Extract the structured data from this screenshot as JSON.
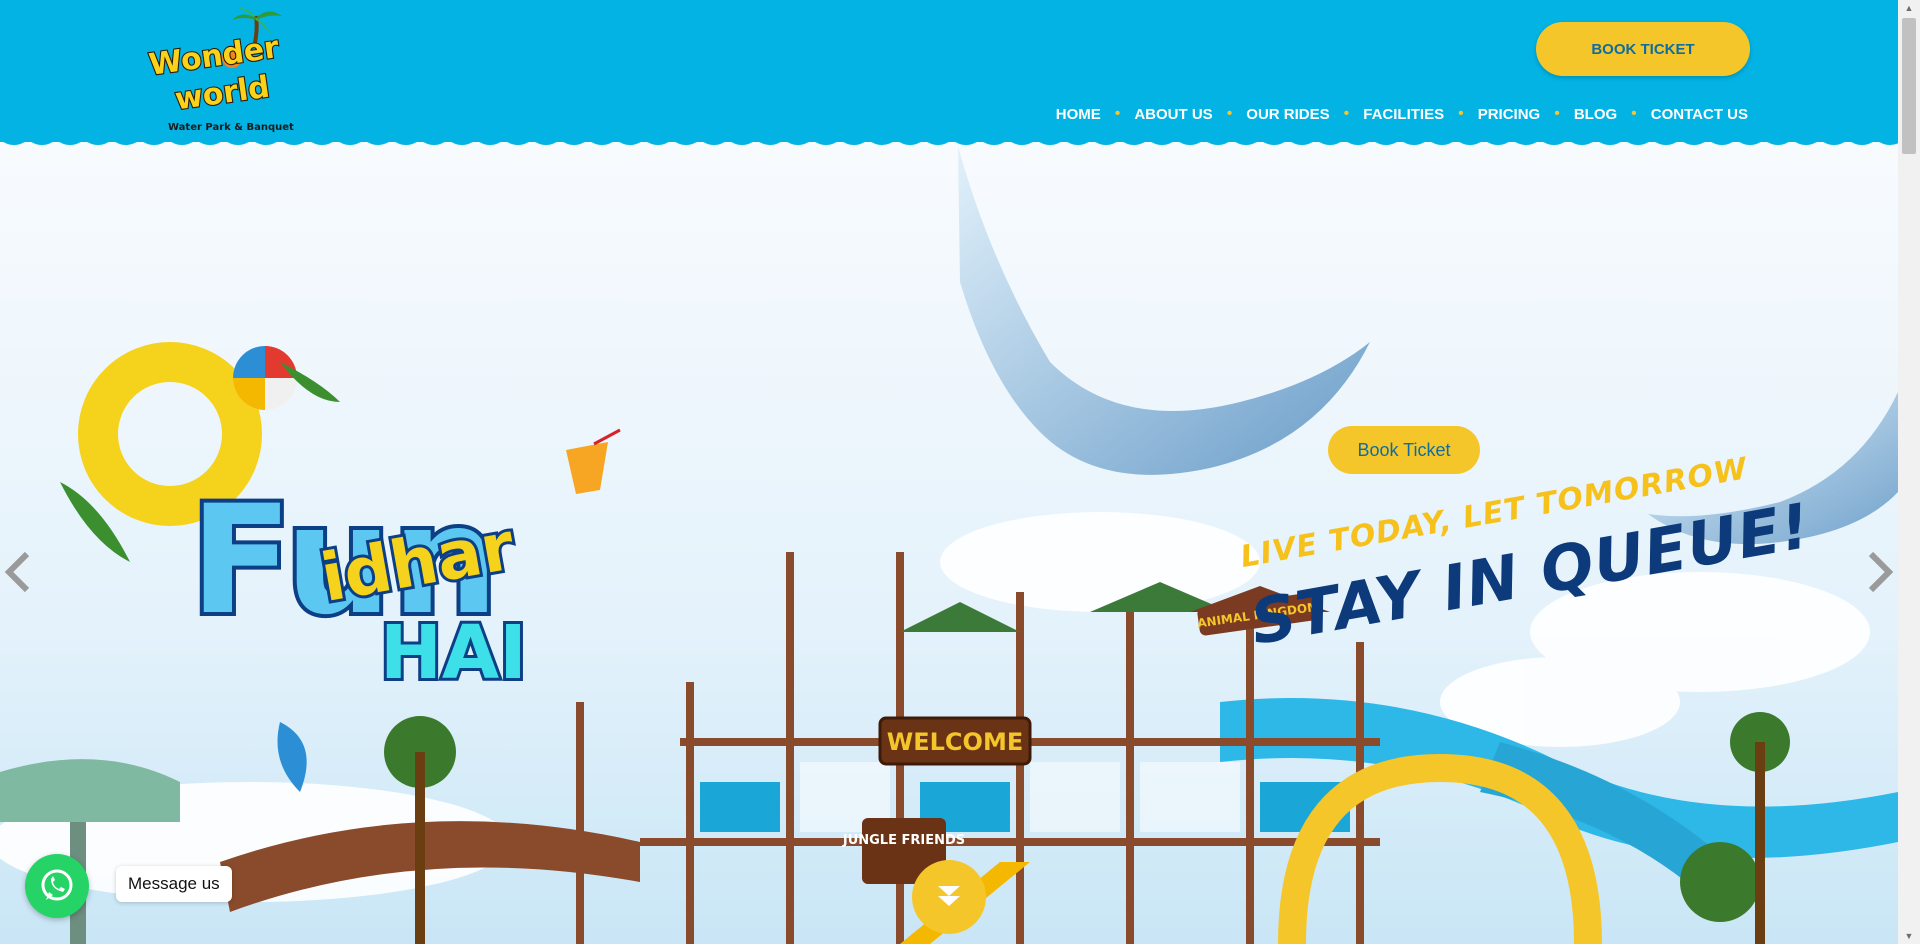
{
  "brand": {
    "logo_line1": "Wonder",
    "logo_line2": "world",
    "logo_sub": "Water Park & Banquet"
  },
  "header": {
    "book_ticket_label": "BOOK TICKET",
    "nav": [
      {
        "label": "HOME"
      },
      {
        "label": "ABOUT US"
      },
      {
        "label": "OUR RIDES"
      },
      {
        "label": "FACILITIES"
      },
      {
        "label": "PRICING"
      },
      {
        "label": "BLOG"
      },
      {
        "label": "CONTACT US"
      }
    ],
    "colors": {
      "background": "#02b3e4",
      "accent": "#f5c62a",
      "nav_separator": "#f5c62a"
    }
  },
  "hero": {
    "fun_word": "Fun",
    "fun_line2": "idhar",
    "fun_line3": "HAI",
    "tagline_top": "LIVE TODAY, LET TOMORROW",
    "tagline_main": "STAY IN QUEUE!",
    "welcome_sign": "WELCOME",
    "jungle_sign": "JUNGLE FRIENDS",
    "animal_sign": "ANIMAL KINGDOM",
    "book_ticket_label": "Book Ticket",
    "prev_icon": "chevron-left-icon",
    "next_icon": "chevron-right-icon",
    "scroll_icon": "double-chevron-down-icon",
    "colors": {
      "tagline_yellow": "#f6c11a",
      "tagline_navy": "#0d3a7a",
      "slide_blue": "#2db8e8"
    }
  },
  "whatsapp": {
    "icon": "whatsapp-icon",
    "label": "Message us",
    "color": "#25d366"
  }
}
